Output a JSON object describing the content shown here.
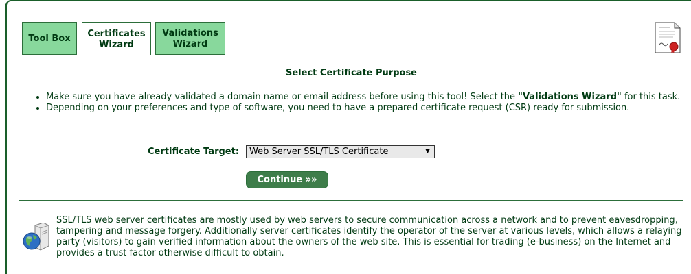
{
  "tabs": [
    {
      "line1": "Tool Box",
      "line2": "",
      "active": false
    },
    {
      "line1": "Certificates",
      "line2": "Wizard",
      "active": true
    },
    {
      "line1": "Validations",
      "line2": "Wizard",
      "active": false
    }
  ],
  "section_title": "Select Certificate Purpose",
  "bullets": {
    "item1_pre": "Make sure you have already validated a domain name or email address before using this tool! Select the ",
    "item1_bold": "\"Validations Wizard\"",
    "item1_post": " for this task.",
    "item2": "Depending on your preferences and type of software, you need to have a prepared certificate request (CSR) ready for submission."
  },
  "form": {
    "target_label": "Certificate Target:",
    "target_value": "Web Server SSL/TLS Certificate",
    "continue_label": "Continue »»"
  },
  "description": "SSL/TLS web server certificates are mostly used by web servers to secure communication across a network and to prevent eavesdropping, tampering and message forgery. Additionally server certificates identify the operator of the server at various levels, which allows a relaying party (visitors) to gain verified information about the owners of the web site. This is essential for trading (e-business) on the Internet and provides a trust factor otherwise difficult to obtain.",
  "colors": {
    "accent_green": "#1a5f2a",
    "tab_inactive": "#88d89c",
    "button": "#3e7d4a",
    "text": "#003a12"
  },
  "icons": {
    "header": "certificate-icon",
    "info": "server-globe-icon"
  }
}
